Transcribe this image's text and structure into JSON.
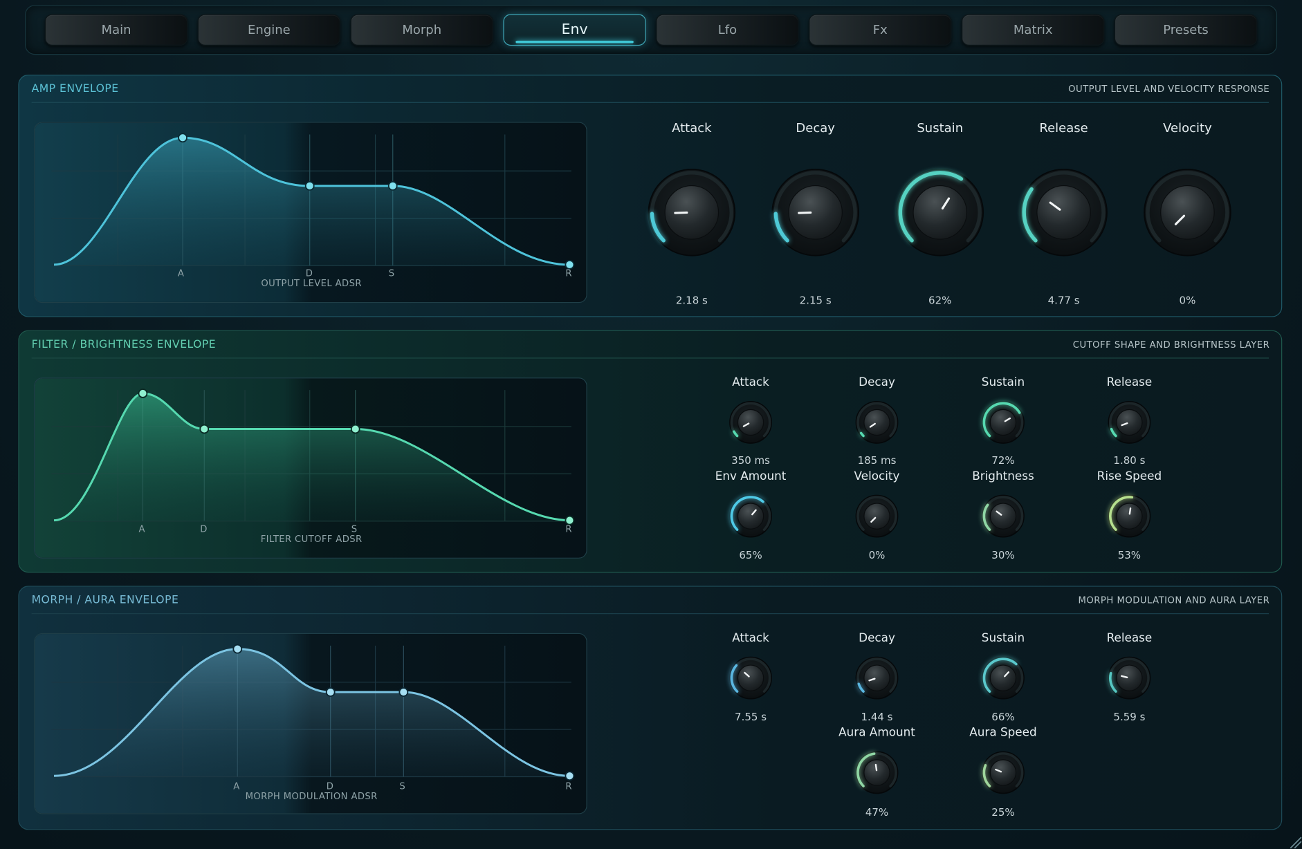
{
  "tabs": [
    {
      "label": "Main",
      "active": false
    },
    {
      "label": "Engine",
      "active": false
    },
    {
      "label": "Morph",
      "active": false
    },
    {
      "label": "Env",
      "active": true
    },
    {
      "label": "Lfo",
      "active": false
    },
    {
      "label": "Fx",
      "active": false
    },
    {
      "label": "Matrix",
      "active": false
    },
    {
      "label": "Presets",
      "active": false
    }
  ],
  "colors": {
    "accent": "#3fc5d4",
    "amp": "#4ec3da",
    "filter": "#56d9b0",
    "morph": "#7cc4e2",
    "knob_arc_amp": "#4ec9d6",
    "knob_arc_fil": "#56d9b0",
    "knob_arc_soft": "#9ed8a0"
  },
  "panels": {
    "amp": {
      "title": "AMP ENVELOPE",
      "subtitle": "OUTPUT LEVEL AND VELOCITY RESPONSE",
      "env": {
        "caption": "OUTPUT LEVEL ADSR",
        "labels": [
          "A",
          "D",
          "S",
          "R"
        ]
      },
      "knobs": [
        {
          "label": "Attack",
          "value": "2.18 s",
          "level": 0.16
        },
        {
          "label": "Decay",
          "value": "2.15 s",
          "level": 0.16
        },
        {
          "label": "Sustain",
          "value": "62%",
          "level": 0.62
        },
        {
          "label": "Release",
          "value": "4.77 s",
          "level": 0.3
        },
        {
          "label": "Velocity",
          "value": "0%",
          "level": 0.0
        }
      ]
    },
    "filter": {
      "title": "FILTER / BRIGHTNESS ENVELOPE",
      "subtitle": "CUTOFF SHAPE AND BRIGHTNESS LAYER",
      "env": {
        "caption": "FILTER CUTOFF ADSR",
        "labels": [
          "A",
          "D",
          "S",
          "R"
        ]
      },
      "knobs": [
        {
          "label": "Attack",
          "value": "350 ms",
          "level": 0.06
        },
        {
          "label": "Decay",
          "value": "185 ms",
          "level": 0.04
        },
        {
          "label": "Sustain",
          "value": "72%",
          "level": 0.72
        },
        {
          "label": "Release",
          "value": "1.80 s",
          "level": 0.09
        },
        {
          "label": "Env Amount",
          "value": "65%",
          "level": 0.65
        },
        {
          "label": "Velocity",
          "value": "0%",
          "level": 0.0
        },
        {
          "label": "Brightness",
          "value": "30%",
          "level": 0.3
        },
        {
          "label": "Rise Speed",
          "value": "53%",
          "level": 0.53
        }
      ]
    },
    "morph": {
      "title": "MORPH / AURA ENVELOPE",
      "subtitle": "MORPH MODULATION AND AURA LAYER",
      "env": {
        "caption": "MORPH MODULATION ADSR",
        "labels": [
          "A",
          "D",
          "S",
          "R"
        ]
      },
      "knobs": [
        {
          "label": "Attack",
          "value": "7.55 s",
          "level": 0.32
        },
        {
          "label": "Decay",
          "value": "1.44 s",
          "level": 0.1
        },
        {
          "label": "Sustain",
          "value": "66%",
          "level": 0.66
        },
        {
          "label": "Release",
          "value": "5.59 s",
          "level": 0.22
        },
        {
          "label": "Aura Amount",
          "value": "47%",
          "level": 0.47
        },
        {
          "label": "Aura Speed",
          "value": "25%",
          "level": 0.25
        }
      ]
    }
  }
}
